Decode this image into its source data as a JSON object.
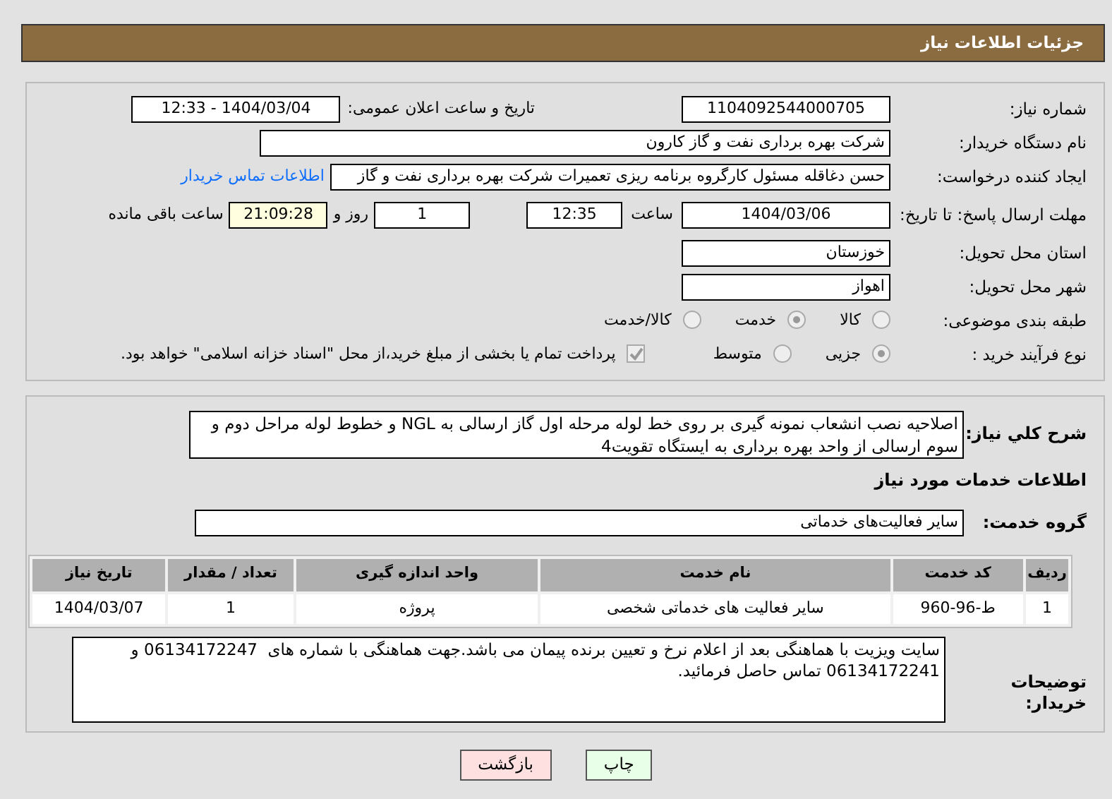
{
  "header": {
    "title": "جزئیات اطلاعات نیاز"
  },
  "need_number": {
    "label": "شماره نیاز:",
    "value": "1104092544000705"
  },
  "announce": {
    "label": "تاریخ و ساعت اعلان عمومی:",
    "value": "1404/03/04 - 12:33"
  },
  "buyer": {
    "label": "نام دستگاه خریدار:",
    "value": "شرکت بهره برداری نفت و گاز کارون"
  },
  "creator": {
    "label": "ایجاد کننده درخواست:",
    "value": "حسن دغاقله مسئول کارگروه برنامه ریزی تعمیرات شرکت بهره برداری نفت و گاز",
    "link": "اطلاعات تماس خریدار"
  },
  "deadline": {
    "label": "مهلت ارسال پاسخ: تا تاریخ:",
    "date": "1404/03/06",
    "time_label": "ساعت",
    "time": "12:35",
    "days": "1",
    "days_label": "روز و",
    "remaining": "21:09:28",
    "remaining_label": "ساعت باقی مانده"
  },
  "province": {
    "label": "استان محل تحویل:",
    "value": "خوزستان"
  },
  "city": {
    "label": "شهر محل تحویل:",
    "value": "اهواز"
  },
  "category": {
    "label": "طبقه بندی موضوعی:",
    "options": [
      {
        "label": "کالا",
        "selected": false
      },
      {
        "label": "خدمت",
        "selected": true
      },
      {
        "label": "کالا/خدمت",
        "selected": false
      }
    ]
  },
  "purchase_type": {
    "label": "نوع فرآیند خرید :",
    "options": [
      {
        "label": "جزیی",
        "selected": true
      },
      {
        "label": "متوسط",
        "selected": false
      }
    ],
    "payment_note": {
      "text": "پرداخت تمام یا بخشی از مبلغ خرید،از محل \"اسناد خزانه اسلامی\" خواهد بود.",
      "checked": true
    }
  },
  "description": {
    "label": "شرح کلي نياز:",
    "value": "اصلاحیه نصب انشعاب نمونه گیری بر روی خط لوله مرحله اول گاز ارسالی به NGL و خطوط لوله مراحل دوم و سوم ارسالی از واحد بهره برداری به ایستگاه تقویت4"
  },
  "services_title": "اطلاعات خدمات مورد نیاز",
  "service_group": {
    "label": "گروه خدمت:",
    "value": "سایر فعالیت‌های خدماتی"
  },
  "table": {
    "columns": [
      "ردیف",
      "کد خدمت",
      "نام خدمت",
      "واحد اندازه گیری",
      "تعداد / مقدار",
      "تاریخ نیاز"
    ],
    "rows": [
      [
        "1",
        "ط-96-960",
        "سایر فعالیت های خدماتی شخصی",
        "پروژه",
        "1",
        "1404/03/07"
      ]
    ]
  },
  "buyer_notes": {
    "label": "توضیحات خریدار:",
    "value": "سایت ویزیت با هماهنگی بعد از اعلام نرخ و تعیین برنده پیمان می باشد.جهت هماهنگی با شماره های  06134172247 و 06134172241 تماس حاصل فرمائید."
  },
  "buttons": [
    {
      "label": "چاپ",
      "kind": "print"
    },
    {
      "label": "بازگشت",
      "kind": "back"
    }
  ]
}
